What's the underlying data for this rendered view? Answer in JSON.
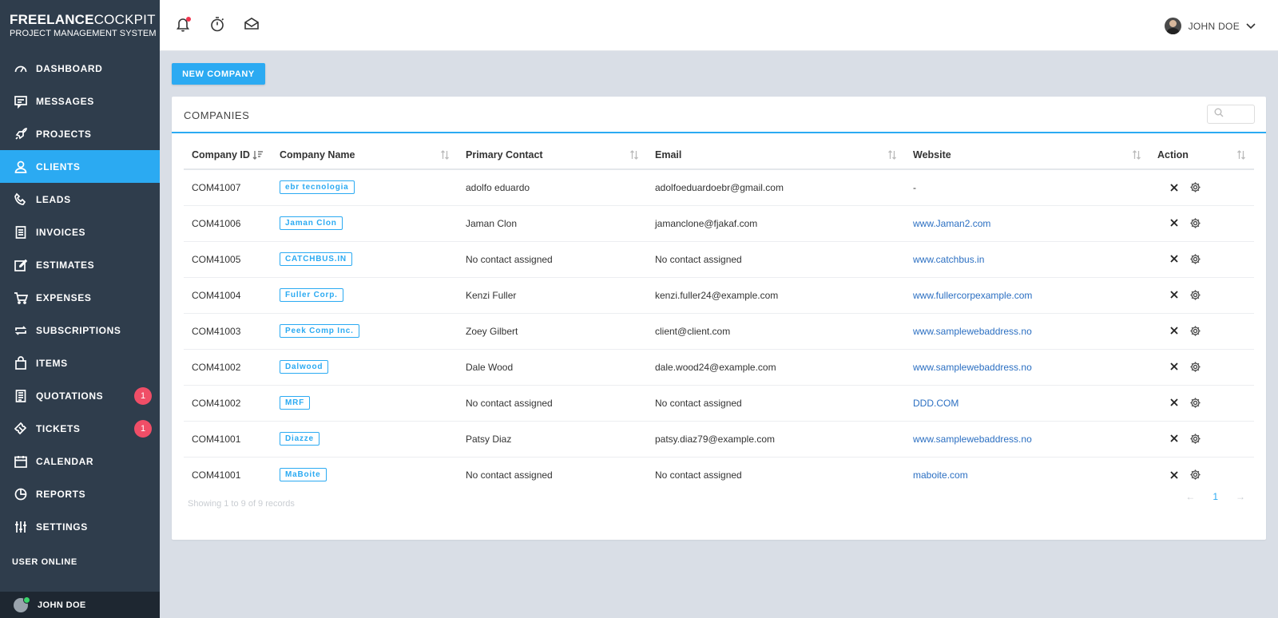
{
  "brand": {
    "name_bold": "FREELANCE",
    "name_rest": "COCKPIT",
    "subtitle": "PROJECT MANAGEMENT SYSTEM"
  },
  "sidebar": {
    "items": [
      {
        "label": "DASHBOARD",
        "icon": "dashboard-icon"
      },
      {
        "label": "MESSAGES",
        "icon": "message-icon"
      },
      {
        "label": "PROJECTS",
        "icon": "rocket-icon"
      },
      {
        "label": "CLIENTS",
        "icon": "user-icon",
        "active": true
      },
      {
        "label": "LEADS",
        "icon": "phone-icon"
      },
      {
        "label": "INVOICES",
        "icon": "invoice-icon"
      },
      {
        "label": "ESTIMATES",
        "icon": "edit-icon"
      },
      {
        "label": "EXPENSES",
        "icon": "cart-icon"
      },
      {
        "label": "SUBSCRIPTIONS",
        "icon": "repeat-icon"
      },
      {
        "label": "ITEMS",
        "icon": "bag-icon"
      },
      {
        "label": "QUOTATIONS",
        "icon": "document-icon",
        "badge": "1"
      },
      {
        "label": "TICKETS",
        "icon": "ticket-icon",
        "badge": "1"
      },
      {
        "label": "CALENDAR",
        "icon": "calendar-icon"
      },
      {
        "label": "REPORTS",
        "icon": "chart-icon"
      },
      {
        "label": "SETTINGS",
        "icon": "sliders-icon"
      }
    ],
    "online_title": "USER ONLINE",
    "online_user": "JOHN DOE"
  },
  "topbar": {
    "user_name": "JOHN DOE"
  },
  "new_company_label": "NEW COMPANY",
  "card": {
    "title": "COMPANIES",
    "search_placeholder": ""
  },
  "table": {
    "headers": [
      "Company ID",
      "Company Name",
      "Primary Contact",
      "Email",
      "Website",
      "Action"
    ],
    "rows": [
      {
        "id": "COM41007",
        "name": "ebr tecnologia",
        "contact": "adolfo eduardo",
        "email": "adolfoeduardoebr@gmail.com",
        "website": "-"
      },
      {
        "id": "COM41006",
        "name": "Jaman Clon",
        "contact": "Jaman Clon",
        "email": "jamanclone@fjakaf.com",
        "website": "www.Jaman2.com"
      },
      {
        "id": "COM41005",
        "name": "CATCHBUS.IN",
        "contact": "No contact assigned",
        "email": "No contact assigned",
        "website": "www.catchbus.in"
      },
      {
        "id": "COM41004",
        "name": "Fuller Corp.",
        "contact": "Kenzi Fuller",
        "email": "kenzi.fuller24@example.com",
        "website": "www.fullercorpexample.com"
      },
      {
        "id": "COM41003",
        "name": "Peek Comp Inc.",
        "contact": "Zoey Gilbert",
        "email": "client@client.com",
        "website": "www.samplewebaddress.no"
      },
      {
        "id": "COM41002",
        "name": "Dalwood",
        "contact": "Dale Wood",
        "email": "dale.wood24@example.com",
        "website": "www.samplewebaddress.no"
      },
      {
        "id": "COM41002",
        "name": "MRF",
        "contact": "No contact assigned",
        "email": "No contact assigned",
        "website": "DDD.COM"
      },
      {
        "id": "COM41001",
        "name": "Diazze",
        "contact": "Patsy Diaz",
        "email": "patsy.diaz79@example.com",
        "website": "www.samplewebaddress.no"
      },
      {
        "id": "COM41001",
        "name": "MaBoite",
        "contact": "No contact assigned",
        "email": "No contact assigned",
        "website": "maboite.com"
      }
    ]
  },
  "footer": {
    "info": "Showing 1 to 9 of 9 records",
    "page": "1"
  },
  "colors": {
    "accent": "#2baaf2",
    "sidebar": "#2f3d4c",
    "badge": "#f04e67",
    "link": "#2b6fc2"
  }
}
